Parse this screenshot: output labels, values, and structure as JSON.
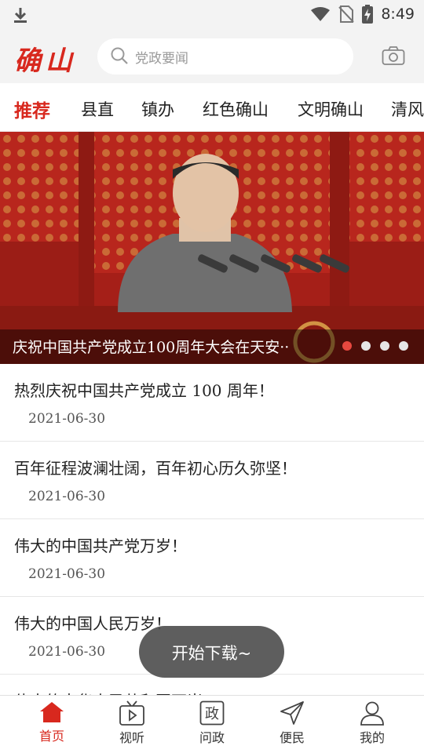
{
  "status_bar": {
    "time": "8:49",
    "icons": [
      "download-icon",
      "wifi-icon",
      "no-sim-icon",
      "battery-charging-icon"
    ]
  },
  "header": {
    "logo": "确山",
    "search_placeholder": "党政要闻",
    "camera_icon": "camera-icon"
  },
  "tabs": [
    {
      "label": "推荐",
      "active": true
    },
    {
      "label": "县直",
      "active": false
    },
    {
      "label": "镇办",
      "active": false
    },
    {
      "label": "红色确山",
      "active": false
    },
    {
      "label": "文明确山",
      "active": false
    },
    {
      "label": "清风",
      "active": false
    }
  ],
  "banner": {
    "caption": "庆祝中国共产党成立100周年大会在天安··",
    "slide_count": 4,
    "active_slide": 1,
    "colors": {
      "active_dot": "#e8483f",
      "background": "#b3241c"
    }
  },
  "news": [
    {
      "title": "热烈庆祝中国共产党成立 100 周年！",
      "date": "2021-06-30"
    },
    {
      "title": "百年征程波澜壮阔，百年初心历久弥坚！",
      "date": "2021-06-30"
    },
    {
      "title": "伟大的中国共产党万岁！",
      "date": "2021-06-30"
    },
    {
      "title": "伟大的中国人民万岁！",
      "date": "2021-06-30"
    },
    {
      "title": "伟大的中华人民共和国万岁！",
      "date": ""
    }
  ],
  "toast": {
    "text": "开始下载~"
  },
  "bottom_nav": [
    {
      "label": "首页",
      "icon": "home-icon",
      "active": true
    },
    {
      "label": "视听",
      "icon": "tv-play-icon",
      "active": false
    },
    {
      "label": "问政",
      "icon": "zheng-icon",
      "icon_text": "政",
      "active": false
    },
    {
      "label": "便民",
      "icon": "send-icon",
      "active": false
    },
    {
      "label": "我的",
      "icon": "user-icon",
      "active": false
    }
  ],
  "colors": {
    "brand": "#d8281e",
    "header_bg": "#f3f3f3"
  }
}
